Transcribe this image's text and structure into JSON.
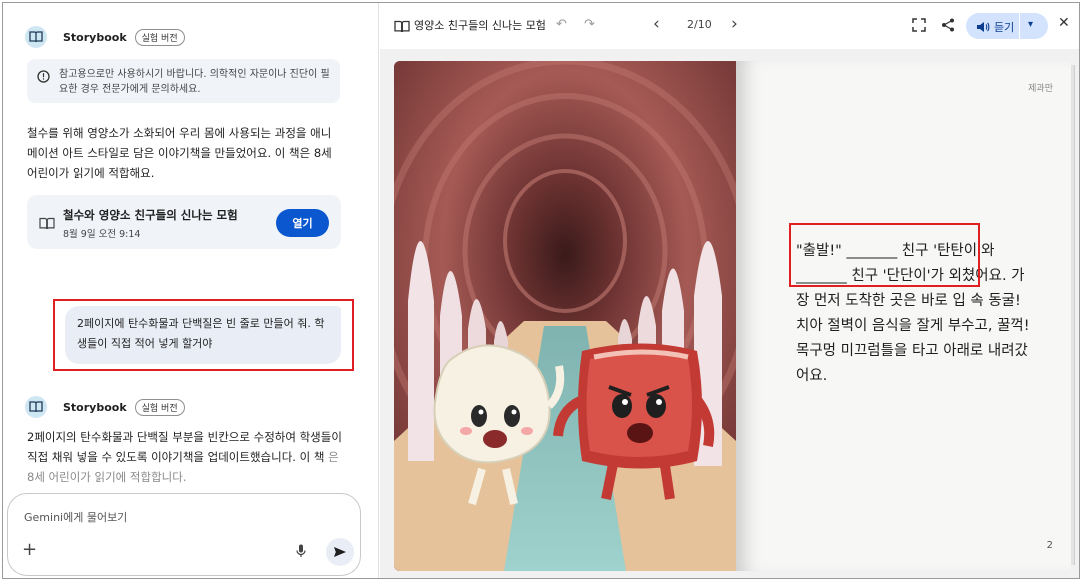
{
  "chat": {
    "bot_name": "Storybook",
    "bot_badge": "실험 버전",
    "notice": "참고용으로만 사용하시기 바랍니다. 의학적인 자문이나 진단이 필요한 경우 전문가에게 문의하세요.",
    "message1": "철수를 위해 영양소가 소화되어 우리 몸에 사용되는 과정을 애니메이션 아트 스타일로 담은 이야기책을 만들었어요. 이 책은 8세 어린이가 읽기에 적합해요.",
    "doc_card": {
      "title": "철수와 영양소 친구들의 신나는 모험",
      "time": "8월 9일 오전 9:14",
      "open_label": "열기"
    },
    "user_message": "2페이지에 탄수화물과 단백질은 빈 줄로 만들어 줘. 학생들이 직접 적어 넣게 할거야",
    "message2_main": "2페이지의 탄수화물과 단백질 부분을 빈칸으로 수정하여 학생들이 직접 채워 넣을 수 있도록 이야기책을 업데이트했습니다. 이 책",
    "message2_faded": "은 8세 어린이가 읽기에 적합합니다.",
    "input_placeholder": "Gemini에게 물어보기"
  },
  "viewer": {
    "title": "영양소 친구들의 신나는 모험",
    "page_indicator": "2/10",
    "listen_label": "듣기"
  },
  "page": {
    "author": "제과만",
    "story_text": "\"출발!\" _______ 친구 '탄탄이'와 _______ 친구 '단단이'가 외쳤어요. 가장 먼저 도착한 곳은 바로 입 속 동굴! 치아 절벽이 음식을 잘게 부수고, 꿀꺽! 목구멍 미끄럼틀을 타고 아래로 내려갔어요.",
    "page_number": "2"
  },
  "colors": {
    "accent": "#0b57d0",
    "highlight_box": "#e02020"
  }
}
